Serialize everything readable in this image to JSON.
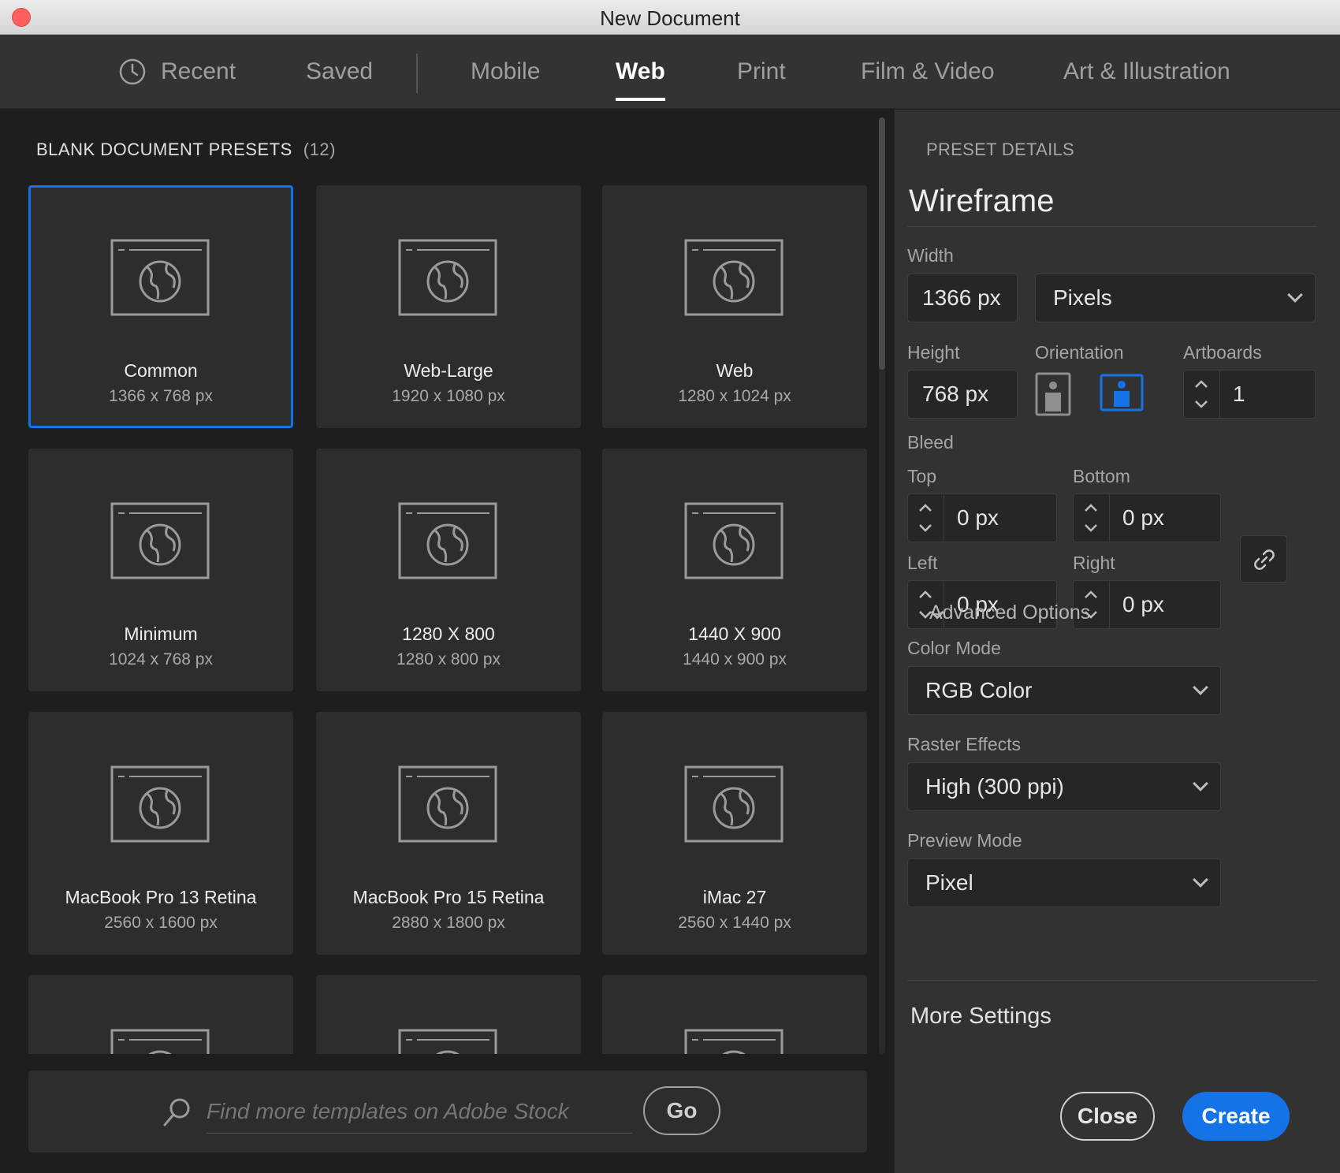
{
  "window": {
    "title": "New Document"
  },
  "tabs": [
    {
      "label": "Recent"
    },
    {
      "label": "Saved"
    },
    {
      "label": "Mobile"
    },
    {
      "label": "Web",
      "active": true
    },
    {
      "label": "Print"
    },
    {
      "label": "Film & Video"
    },
    {
      "label": "Art & Illustration"
    }
  ],
  "presets": {
    "heading": "BLANK DOCUMENT PRESETS",
    "count": "(12)",
    "items": [
      {
        "name": "Common",
        "size": "1366 x 768 px",
        "selected": true
      },
      {
        "name": "Web-Large",
        "size": "1920 x 1080 px"
      },
      {
        "name": "Web",
        "size": "1280 x 1024 px"
      },
      {
        "name": "Minimum",
        "size": "1024 x 768 px"
      },
      {
        "name": "1280 X 800",
        "size": "1280 x 800 px"
      },
      {
        "name": "1440 X 900",
        "size": "1440 x 900 px"
      },
      {
        "name": "MacBook Pro 13 Retina",
        "size": "2560 x 1600 px"
      },
      {
        "name": "MacBook Pro 15 Retina",
        "size": "2880 x 1800 px"
      },
      {
        "name": "iMac 27",
        "size": "2560 x 1440 px"
      }
    ]
  },
  "stock": {
    "placeholder": "Find more templates on Adobe Stock",
    "go_label": "Go"
  },
  "details": {
    "heading": "PRESET DETAILS",
    "name": "Wireframe",
    "width_label": "Width",
    "width_value": "1366 px",
    "units_value": "Pixels",
    "height_label": "Height",
    "height_value": "768 px",
    "orientation_label": "Orientation",
    "orientation_selected": "landscape",
    "artboards_label": "Artboards",
    "artboards_value": "1",
    "bleed_label": "Bleed",
    "top_label": "Top",
    "top_value": "0 px",
    "bottom_label": "Bottom",
    "bottom_value": "0 px",
    "left_label": "Left",
    "left_value": "0 px",
    "right_label": "Right",
    "right_value": "0 px",
    "advanced_label": "Advanced Options",
    "color_mode_label": "Color Mode",
    "color_mode_value": "RGB Color",
    "raster_label": "Raster Effects",
    "raster_value": "High (300 ppi)",
    "preview_label": "Preview Mode",
    "preview_value": "Pixel",
    "more_settings": "More Settings",
    "close_label": "Close",
    "create_label": "Create"
  },
  "colors": {
    "accent": "#1473e6",
    "panel": "#323232",
    "card": "#2d2d2d"
  }
}
